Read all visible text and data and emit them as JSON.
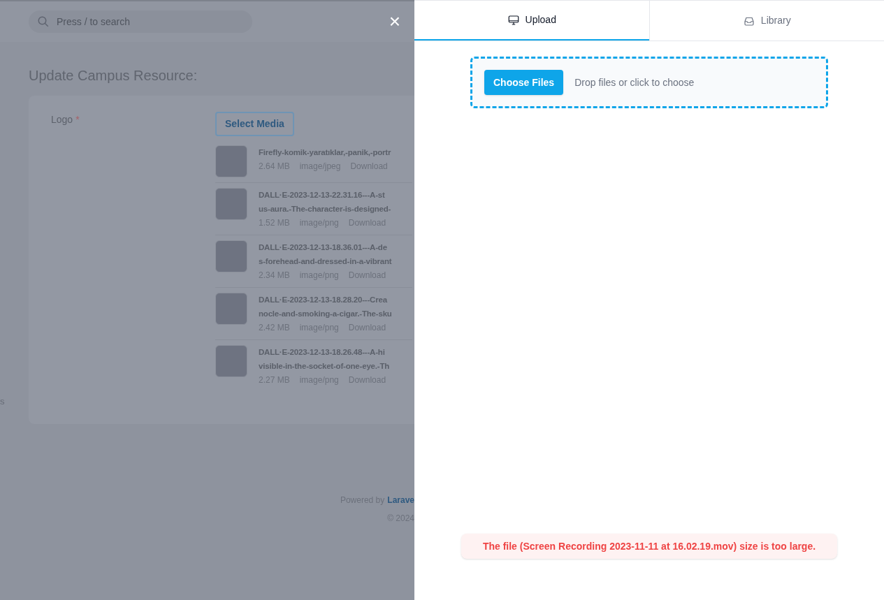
{
  "background_page": {
    "search": {
      "placeholder": "Press / to search"
    },
    "sidebar_fragment": "s",
    "heading": "Update Campus Resource:",
    "field": {
      "label": "Logo",
      "required_mark": "*",
      "button": "Select Media"
    },
    "files": [
      {
        "name_lines": [
          "Firefly-komik-yaratıklar,-panik,-portr"
        ],
        "size": "2.64 MB",
        "type": "image/jpeg",
        "action": "Download"
      },
      {
        "name_lines": [
          "DALL·E-2023-12-13-22.31.16---A-st",
          "us-aura.-The-character-is-designed-"
        ],
        "size": "1.52 MB",
        "type": "image/png",
        "action": "Download"
      },
      {
        "name_lines": [
          "DALL·E-2023-12-13-18.36.01---A-de",
          "s-forehead-and-dressed-in-a-vibrant"
        ],
        "size": "2.34 MB",
        "type": "image/png",
        "action": "Download"
      },
      {
        "name_lines": [
          "DALL·E-2023-12-13-18.28.20---Crea",
          "nocle-and-smoking-a-cigar.-The-sku"
        ],
        "size": "2.42 MB",
        "type": "image/png",
        "action": "Download"
      },
      {
        "name_lines": [
          "DALL·E-2023-12-13-18.26.48---A-hi",
          "visible-in-the-socket-of-one-eye.-Th"
        ],
        "size": "2.27 MB",
        "type": "image/png",
        "action": "Download"
      }
    ],
    "footer": {
      "powered_by": "Powered by",
      "link": "Larave",
      "copyright": "© 2024"
    }
  },
  "close_button": "×",
  "panel": {
    "tabs": [
      {
        "label": "Upload",
        "kind": "monitor",
        "selected": true
      },
      {
        "label": "Library",
        "kind": "inbox",
        "selected": false
      }
    ],
    "dropzone": {
      "button": "Choose Files",
      "hint": "Drop files or click to choose"
    },
    "error": "The file (Screen Recording 2023-11-11 at 16.02.19.mov) size is too large."
  }
}
